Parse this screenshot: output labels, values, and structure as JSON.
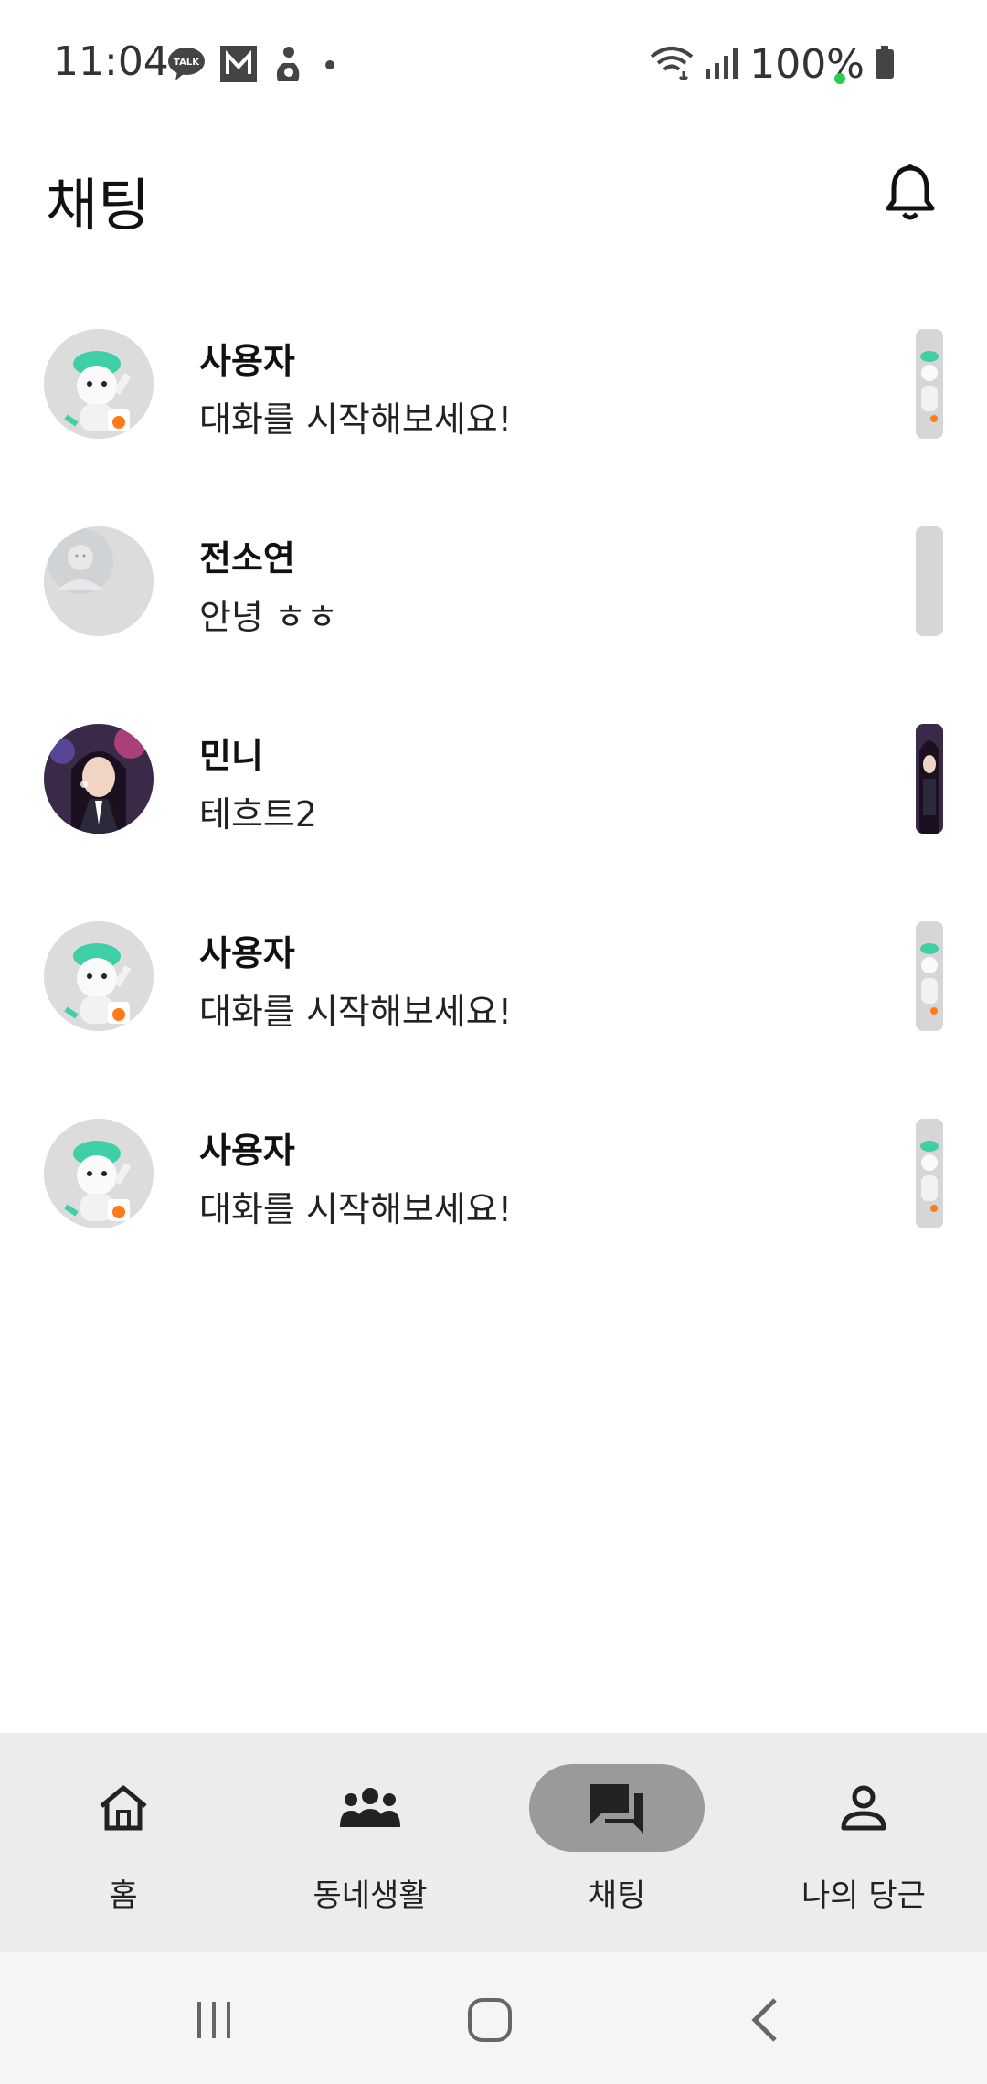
{
  "status_bar": {
    "time": "11:04",
    "battery": "100%",
    "notification_icons": [
      "kakaotalk-icon",
      "gmail-icon",
      "figure-icon",
      "dot-icon"
    ],
    "system_icons": [
      "wifi-icon",
      "signal-icon",
      "battery-icon"
    ]
  },
  "header": {
    "title": "채팅",
    "notification_icon": "bell-icon"
  },
  "chats": [
    {
      "name": "사용자",
      "last_message": "대화를 시작해보세요!",
      "avatar": "mascot"
    },
    {
      "name": "전소연",
      "last_message": "안녕 ㅎㅎ",
      "avatar": "default-profile"
    },
    {
      "name": "민니",
      "last_message": "테흐트2",
      "avatar": "photo"
    },
    {
      "name": "사용자",
      "last_message": "대화를 시작해보세요!",
      "avatar": "mascot"
    },
    {
      "name": "사용자",
      "last_message": "대화를 시작해보세요!",
      "avatar": "mascot"
    }
  ],
  "bottom_nav": {
    "active": "채팅",
    "items": [
      {
        "label": "홈",
        "icon": "home-icon"
      },
      {
        "label": "동네생활",
        "icon": "people-icon"
      },
      {
        "label": "채팅",
        "icon": "chat-icon"
      },
      {
        "label": "나의 당근",
        "icon": "person-icon"
      }
    ]
  },
  "system_nav": [
    "recent-apps-icon",
    "home-button-icon",
    "back-icon"
  ],
  "colors": {
    "nav_background": "#ececec",
    "active_pill": "#9a9a9a",
    "avatar_placeholder": "#dcdcdc",
    "mascot_green": "#3fcfa8"
  }
}
